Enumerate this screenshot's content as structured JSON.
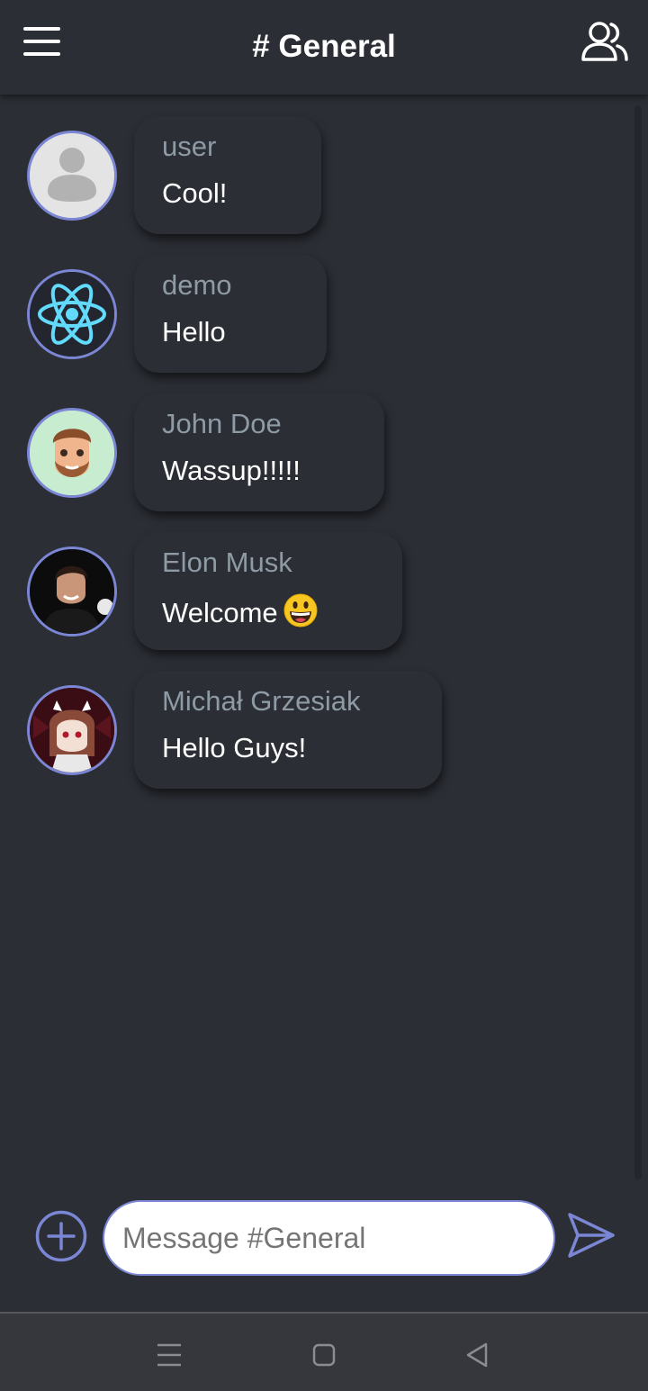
{
  "header": {
    "title": "# General",
    "menu_icon": "hamburger-menu-icon",
    "users_icon": "users-icon"
  },
  "messages": [
    {
      "author": "user",
      "text": "Cool!",
      "avatar": "default-user-avatar"
    },
    {
      "author": "demo",
      "text": "Hello",
      "avatar": "react-logo-avatar"
    },
    {
      "author": "John Doe",
      "text": "Wassup!!!!!",
      "avatar": "memoji-avatar"
    },
    {
      "author": "Elon Musk",
      "text": "Welcome",
      "emoji": "grinning-face-emoji",
      "avatar": "photo-avatar"
    },
    {
      "author": "Michał Grzesiak",
      "text": "Hello Guys!",
      "avatar": "anime-avatar"
    }
  ],
  "composer": {
    "placeholder": "Message #General",
    "value": "",
    "add_icon": "plus-circle-icon",
    "send_icon": "send-icon"
  },
  "system_nav": {
    "icons": [
      "recent-apps-icon",
      "home-icon",
      "back-icon"
    ]
  },
  "colors": {
    "background": "#2b2e35",
    "accent": "#7b86d4",
    "author_text": "#8e9aa4",
    "message_text": "#ffffff",
    "navbar": "#35373c"
  }
}
